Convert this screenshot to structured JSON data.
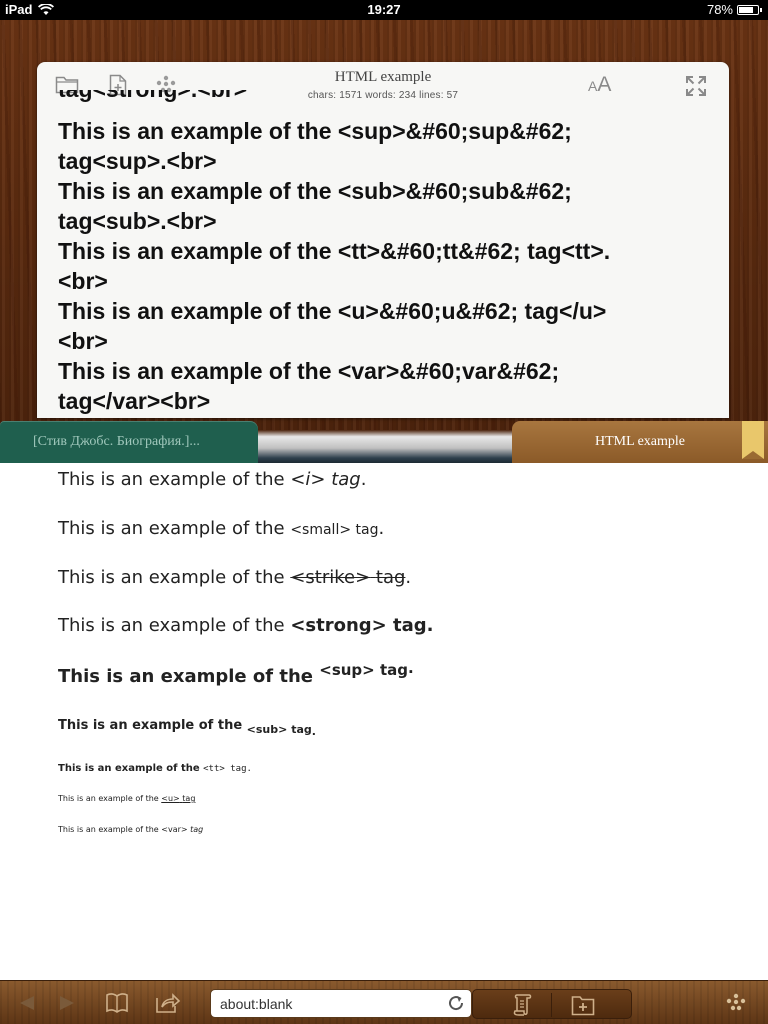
{
  "status_bar": {
    "carrier": "iPad",
    "time": "19:27",
    "battery": "78%",
    "battery_level": 0.78
  },
  "editor": {
    "title": "HTML example",
    "stats": "chars: 1571 words: 234 lines: 57",
    "font_size_small": "A",
    "font_size_large": "A",
    "cut_line": "tag<strong>.<br>",
    "lines": [
      "This is an example of the <sup>&#60;sup&#62;",
      "tag<sup>.<br>",
      "This is an example of the <sub>&#60;sub&#62;",
      "tag<sub>.<br>",
      "This is an example of the <tt>&#60;tt&#62; tag<tt>.",
      "<br>",
      "This is an example of the <u>&#60;u&#62; tag</u>",
      "<br>",
      "This is an example of the <var>&#60;var&#62;",
      "tag</var><br>"
    ]
  },
  "tabs": {
    "left": "[Стив Джобс. Биография.]...",
    "right": "HTML example"
  },
  "preview": {
    "prefix": "This is an example of the",
    "i": {
      "tag": "<i>",
      "word": "tag",
      "end": "."
    },
    "small": {
      "tag": "<small>",
      "word": "tag",
      "end": "."
    },
    "strike": {
      "tag": "<strike>",
      "word": "tag",
      "end": "."
    },
    "strong": {
      "tag": "<strong>",
      "word": "tag."
    },
    "sup": {
      "text": "<sup> tag",
      "end": "."
    },
    "sub": {
      "text": "<sub> tag",
      "end": "."
    },
    "tt": {
      "text": "<tt> tag",
      "end": "."
    },
    "u": {
      "prefix": "This is an example of the",
      "tag": "<u>",
      "word": "tag"
    },
    "var": {
      "prefix": "This is an example of the",
      "tag": "<var>",
      "word": "tag"
    }
  },
  "bottom_bar": {
    "url": "about:blank"
  },
  "icons": {
    "folder": "folder-icon",
    "new_file": "new-file-icon",
    "more": "more-dots-icon",
    "font_size": "font-size-icon",
    "fullscreen": "fullscreen-icon",
    "back": "back-arrow-icon",
    "forward": "forward-arrow-icon",
    "bookmarks": "book-icon",
    "share": "share-icon",
    "reload": "reload-icon",
    "scroll": "scroll-icon",
    "add_tab": "add-tab-icon",
    "menu": "menu-dots-icon"
  },
  "colors": {
    "wood": "#5a2a0f",
    "tab_left": "#1f5f4e",
    "tab_right": "#8b5a28",
    "ribbon": "#e9c76b"
  }
}
